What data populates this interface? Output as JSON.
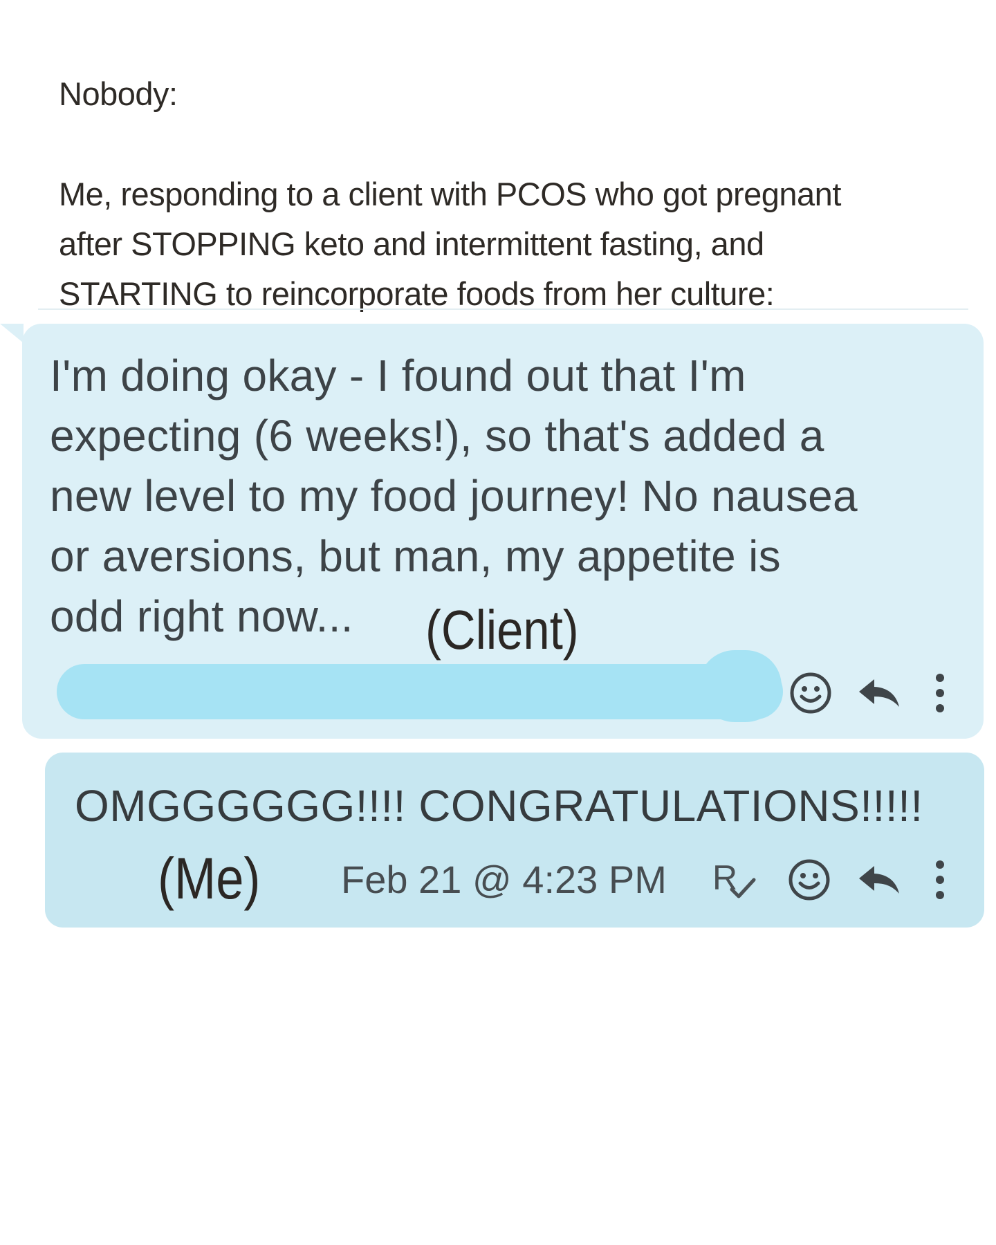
{
  "caption": {
    "nobody": "Nobody:",
    "setup_lines": [
      "Me, responding to a client with PCOS who got pregnant",
      "after STOPPING keto and intermittent fasting, and",
      "STARTING to reincorporate foods from her culture:"
    ]
  },
  "client_message": {
    "lines": [
      "I'm doing okay - I found out that I'm",
      "expecting (6 weeks!), so that's added a",
      "new level to my food journey! No nausea",
      "or aversions, but man, my appetite is",
      "odd right now..."
    ],
    "label": "(Client)",
    "icons": [
      "emoji-react-icon",
      "reply-icon",
      "more-options-icon"
    ]
  },
  "my_message": {
    "text": "OMGGGGGG!!!! CONGRATULATIONS!!!!!",
    "label": "(Me)",
    "timestamp": "Feb 21 @ 4:23 PM",
    "read_receipt": "R",
    "icons": [
      "read-receipt-icon",
      "emoji-react-icon",
      "reply-icon",
      "more-options-icon"
    ]
  },
  "colors": {
    "client_bubble": "#dcf0f7",
    "my_bubble": "#c7e7f1",
    "redaction": "#a6e3f4",
    "icon": "#3f4549"
  }
}
